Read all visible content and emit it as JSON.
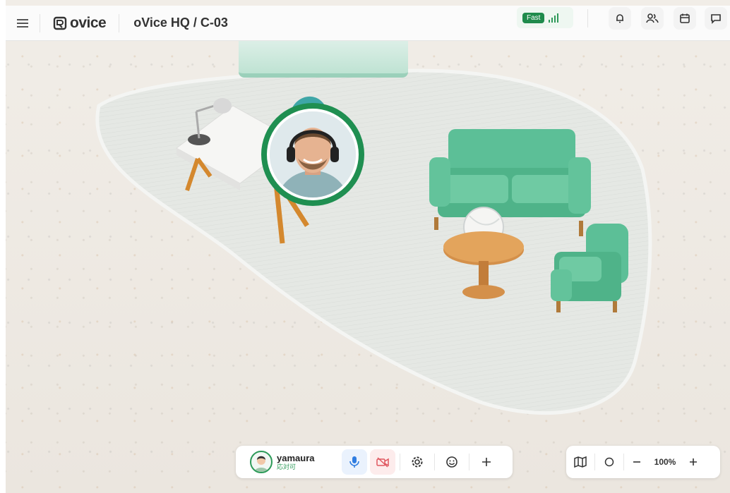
{
  "header": {
    "brand": "ovice",
    "room_path": "oVice HQ / C-03",
    "connection_label": "Fast",
    "icons": [
      "menu-icon",
      "bell-icon",
      "people-icon",
      "calendar-icon",
      "chat-icon"
    ]
  },
  "colors": {
    "accent": "#1f8b4c",
    "sofa": "#5cbf97",
    "rug": "#e6e8e5"
  },
  "user": {
    "name": "yamaura",
    "status": "応対可"
  },
  "controls": {
    "icons": [
      "microphone-icon",
      "camera-off-icon",
      "settings-icon",
      "emoji-icon",
      "plus-icon"
    ],
    "mic_on": true,
    "camera_on": false
  },
  "zoom": {
    "value": "100%",
    "icons": [
      "map-icon",
      "locate-icon",
      "zoom-out-icon",
      "zoom-in-icon"
    ]
  }
}
